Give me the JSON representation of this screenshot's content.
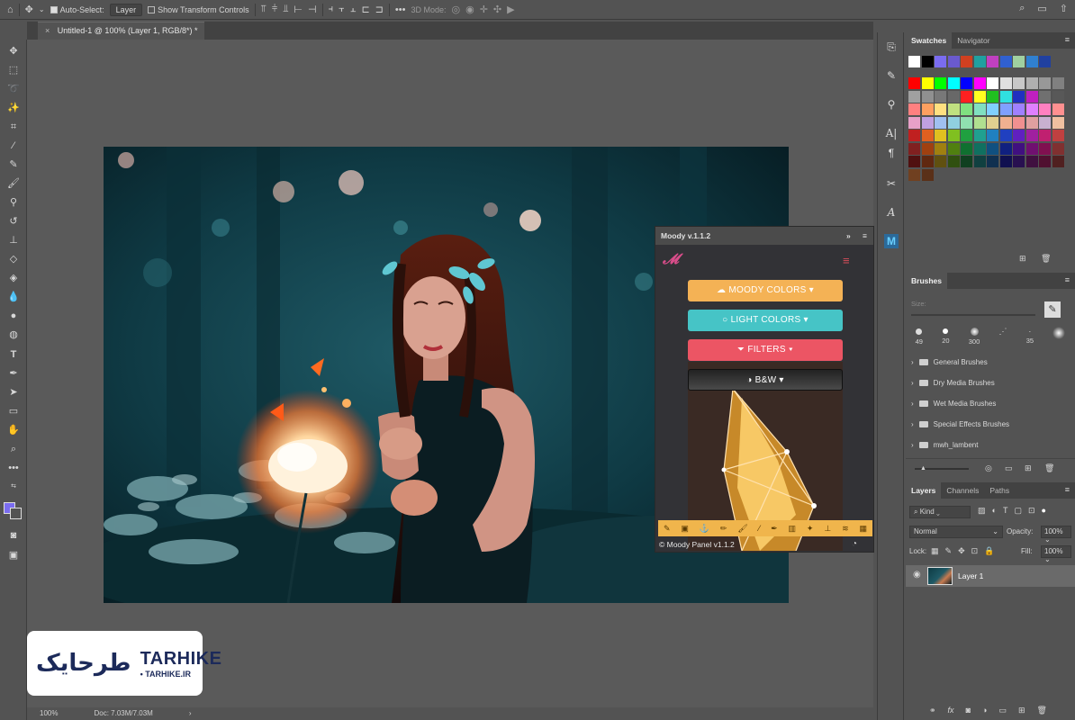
{
  "optbar": {
    "auto_select_label": "Auto-Select:",
    "auto_select_value": "Layer",
    "transform_label": "Show Transform Controls",
    "mode_label": "3D Mode:"
  },
  "doc_tab": {
    "title": "Untitled-1 @ 100% (Layer 1, RGB/8*) *"
  },
  "status": {
    "zoom": "100%",
    "doc": "Doc: 7.03M/7.03M"
  },
  "swatches_panel": {
    "tabs": [
      "Swatches",
      "Navigator"
    ]
  },
  "brushes_panel": {
    "title": "Brushes",
    "size_label": "Size:",
    "presets": [
      "49",
      "20",
      "300",
      "",
      "35",
      ""
    ],
    "folders": [
      "General Brushes",
      "Dry Media Brushes",
      "Wet Media Brushes",
      "Special Effects Brushes",
      "mwh_lambent"
    ]
  },
  "layers_panel": {
    "tabs": [
      "Layers",
      "Channels",
      "Paths"
    ],
    "kind_label": "Kind",
    "blend_mode": "Normal",
    "opacity_label": "Opacity:",
    "opacity_value": "100%",
    "lock_label": "Lock:",
    "fill_label": "Fill:",
    "fill_value": "100%",
    "layer_name": "Layer 1"
  },
  "moody": {
    "title": "Moody v.1.1.2",
    "btn_moody": "MOODY COLORS",
    "btn_light": "LIGHT COLORS",
    "btn_filters": "FILTERS",
    "btn_bw": "B&W",
    "footer": "© Moody Panel v1.1.2"
  },
  "watermark": {
    "brand": "TARHIKE",
    "url": "• TARHIKE.IR",
    "logo_text": "طرحایک"
  },
  "colors": {
    "ui_bg": "#535353",
    "moody_orange": "#f4b255",
    "moody_teal": "#46c4c6",
    "moody_red": "#ec5564",
    "fg_swatch": "#7a6cf0"
  }
}
